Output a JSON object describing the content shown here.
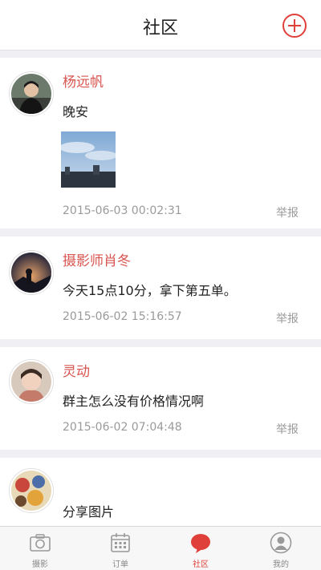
{
  "header": {
    "title": "社区"
  },
  "posts": [
    {
      "author": "杨远帆",
      "text": "晚安",
      "date": "2015-06-03 00:02:31",
      "report": "举报"
    },
    {
      "author": "摄影师肖冬",
      "text": "今天15点10分，拿下第五单。",
      "date": "2015-06-02 15:16:57",
      "report": "举报"
    },
    {
      "author": "灵动",
      "text": "群主怎么没有价格情况啊",
      "date": "2015-06-02 07:04:48",
      "report": "举报"
    },
    {
      "author": "",
      "text": "分享图片"
    }
  ],
  "tabs": [
    {
      "label": "摄影",
      "icon": "camera-icon"
    },
    {
      "label": "订单",
      "icon": "calendar-icon"
    },
    {
      "label": "社区",
      "icon": "chat-bubble-icon",
      "active": true
    },
    {
      "label": "我的",
      "icon": "user-icon"
    }
  ],
  "colors": {
    "accent": "#e0403a",
    "author": "#d9544f",
    "meta": "#9a9a9a",
    "background": "#efeff4"
  }
}
